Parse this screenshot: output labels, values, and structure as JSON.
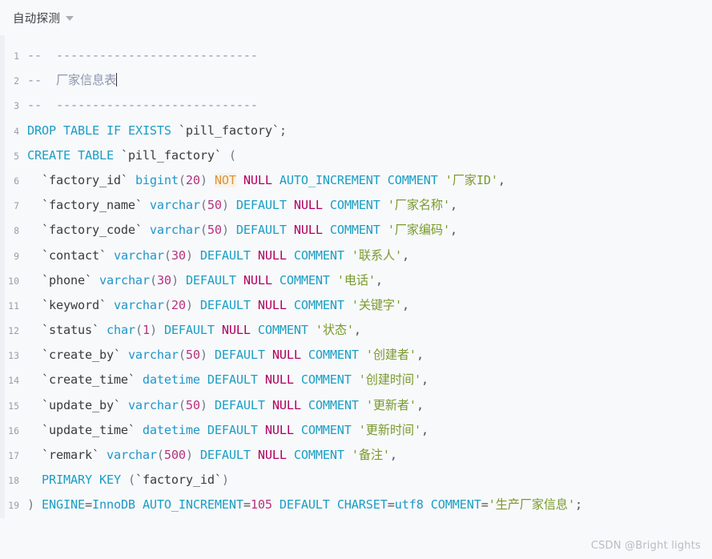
{
  "header": {
    "detect_mode_label": "自动探测",
    "caret_icon": "chevron-down-icon"
  },
  "watermark": "CSDN @Bright lights",
  "colors": {
    "background": "#f8f9fb",
    "gutter": "#eef0f4",
    "line_number": "#9a9ea6",
    "comment": "#8a97ad",
    "keyword": "#2196c9",
    "number": "#b5337f",
    "null_keyword": "#b00060",
    "not_keyword": "#d9943a",
    "string": "#7a9a2e",
    "identifier": "#3b3b3b",
    "watermark": "#b9bcc2"
  },
  "editor": {
    "language": "sql",
    "cursor_line": 2,
    "line_numbers": [
      1,
      2,
      3,
      4,
      5,
      6,
      7,
      8,
      9,
      10,
      11,
      12,
      13,
      14,
      15,
      16,
      17,
      18,
      19
    ],
    "lines": [
      {
        "n": "1",
        "tokens": [
          {
            "t": "comment",
            "v": "--  ----------------------------"
          }
        ]
      },
      {
        "n": "2",
        "tokens": [
          {
            "t": "comment",
            "v": "--  厂家信息表"
          },
          {
            "t": "cursor",
            "v": ""
          }
        ]
      },
      {
        "n": "3",
        "tokens": [
          {
            "t": "comment",
            "v": "--  ----------------------------"
          }
        ]
      },
      {
        "n": "4",
        "tokens": [
          {
            "t": "kw",
            "v": "DROP"
          },
          {
            "t": "plain",
            "v": " "
          },
          {
            "t": "kw",
            "v": "TABLE"
          },
          {
            "t": "plain",
            "v": " "
          },
          {
            "t": "kw",
            "v": "IF"
          },
          {
            "t": "plain",
            "v": " "
          },
          {
            "t": "kw",
            "v": "EXISTS"
          },
          {
            "t": "plain",
            "v": " "
          },
          {
            "t": "ident",
            "v": "`pill_factory`"
          },
          {
            "t": "punct",
            "v": ";"
          }
        ]
      },
      {
        "n": "5",
        "tokens": [
          {
            "t": "kw",
            "v": "CREATE"
          },
          {
            "t": "plain",
            "v": " "
          },
          {
            "t": "kw",
            "v": "TABLE"
          },
          {
            "t": "plain",
            "v": " "
          },
          {
            "t": "ident",
            "v": "`pill_factory`"
          },
          {
            "t": "plain",
            "v": " "
          },
          {
            "t": "paren",
            "v": "("
          }
        ]
      },
      {
        "n": "6",
        "tokens": [
          {
            "t": "plain",
            "v": "  "
          },
          {
            "t": "ident",
            "v": "`factory_id`"
          },
          {
            "t": "plain",
            "v": " "
          },
          {
            "t": "type",
            "v": "bigint"
          },
          {
            "t": "paren",
            "v": "("
          },
          {
            "t": "num",
            "v": "20"
          },
          {
            "t": "paren",
            "v": ")"
          },
          {
            "t": "plain",
            "v": " "
          },
          {
            "t": "not",
            "v": "NOT"
          },
          {
            "t": "plain",
            "v": " "
          },
          {
            "t": "null",
            "v": "NULL"
          },
          {
            "t": "plain",
            "v": " "
          },
          {
            "t": "kw",
            "v": "AUTO_INCREMENT"
          },
          {
            "t": "plain",
            "v": " "
          },
          {
            "t": "kw",
            "v": "COMMENT"
          },
          {
            "t": "plain",
            "v": " "
          },
          {
            "t": "str",
            "v": "'厂家ID'"
          },
          {
            "t": "punct",
            "v": ","
          }
        ]
      },
      {
        "n": "7",
        "tokens": [
          {
            "t": "plain",
            "v": "  "
          },
          {
            "t": "ident",
            "v": "`factory_name`"
          },
          {
            "t": "plain",
            "v": " "
          },
          {
            "t": "type",
            "v": "varchar"
          },
          {
            "t": "paren",
            "v": "("
          },
          {
            "t": "num",
            "v": "50"
          },
          {
            "t": "paren",
            "v": ")"
          },
          {
            "t": "plain",
            "v": " "
          },
          {
            "t": "kw",
            "v": "DEFAULT"
          },
          {
            "t": "plain",
            "v": " "
          },
          {
            "t": "null",
            "v": "NULL"
          },
          {
            "t": "plain",
            "v": " "
          },
          {
            "t": "kw",
            "v": "COMMENT"
          },
          {
            "t": "plain",
            "v": " "
          },
          {
            "t": "str",
            "v": "'厂家名称'"
          },
          {
            "t": "punct",
            "v": ","
          }
        ]
      },
      {
        "n": "8",
        "tokens": [
          {
            "t": "plain",
            "v": "  "
          },
          {
            "t": "ident",
            "v": "`factory_code`"
          },
          {
            "t": "plain",
            "v": " "
          },
          {
            "t": "type",
            "v": "varchar"
          },
          {
            "t": "paren",
            "v": "("
          },
          {
            "t": "num",
            "v": "50"
          },
          {
            "t": "paren",
            "v": ")"
          },
          {
            "t": "plain",
            "v": " "
          },
          {
            "t": "kw",
            "v": "DEFAULT"
          },
          {
            "t": "plain",
            "v": " "
          },
          {
            "t": "null",
            "v": "NULL"
          },
          {
            "t": "plain",
            "v": " "
          },
          {
            "t": "kw",
            "v": "COMMENT"
          },
          {
            "t": "plain",
            "v": " "
          },
          {
            "t": "str",
            "v": "'厂家编码'"
          },
          {
            "t": "punct",
            "v": ","
          }
        ]
      },
      {
        "n": "9",
        "tokens": [
          {
            "t": "plain",
            "v": "  "
          },
          {
            "t": "ident",
            "v": "`contact`"
          },
          {
            "t": "plain",
            "v": " "
          },
          {
            "t": "type",
            "v": "varchar"
          },
          {
            "t": "paren",
            "v": "("
          },
          {
            "t": "num",
            "v": "30"
          },
          {
            "t": "paren",
            "v": ")"
          },
          {
            "t": "plain",
            "v": " "
          },
          {
            "t": "kw",
            "v": "DEFAULT"
          },
          {
            "t": "plain",
            "v": " "
          },
          {
            "t": "null",
            "v": "NULL"
          },
          {
            "t": "plain",
            "v": " "
          },
          {
            "t": "kw",
            "v": "COMMENT"
          },
          {
            "t": "plain",
            "v": " "
          },
          {
            "t": "str",
            "v": "'联系人'"
          },
          {
            "t": "punct",
            "v": ","
          }
        ]
      },
      {
        "n": "10",
        "tokens": [
          {
            "t": "plain",
            "v": "  "
          },
          {
            "t": "ident",
            "v": "`phone`"
          },
          {
            "t": "plain",
            "v": " "
          },
          {
            "t": "type",
            "v": "varchar"
          },
          {
            "t": "paren",
            "v": "("
          },
          {
            "t": "num",
            "v": "30"
          },
          {
            "t": "paren",
            "v": ")"
          },
          {
            "t": "plain",
            "v": " "
          },
          {
            "t": "kw",
            "v": "DEFAULT"
          },
          {
            "t": "plain",
            "v": " "
          },
          {
            "t": "null",
            "v": "NULL"
          },
          {
            "t": "plain",
            "v": " "
          },
          {
            "t": "kw",
            "v": "COMMENT"
          },
          {
            "t": "plain",
            "v": " "
          },
          {
            "t": "str",
            "v": "'电话'"
          },
          {
            "t": "punct",
            "v": ","
          }
        ]
      },
      {
        "n": "11",
        "tokens": [
          {
            "t": "plain",
            "v": "  "
          },
          {
            "t": "ident",
            "v": "`keyword`"
          },
          {
            "t": "plain",
            "v": " "
          },
          {
            "t": "type",
            "v": "varchar"
          },
          {
            "t": "paren",
            "v": "("
          },
          {
            "t": "num",
            "v": "20"
          },
          {
            "t": "paren",
            "v": ")"
          },
          {
            "t": "plain",
            "v": " "
          },
          {
            "t": "kw",
            "v": "DEFAULT"
          },
          {
            "t": "plain",
            "v": " "
          },
          {
            "t": "null",
            "v": "NULL"
          },
          {
            "t": "plain",
            "v": " "
          },
          {
            "t": "kw",
            "v": "COMMENT"
          },
          {
            "t": "plain",
            "v": " "
          },
          {
            "t": "str",
            "v": "'关键字'"
          },
          {
            "t": "punct",
            "v": ","
          }
        ]
      },
      {
        "n": "12",
        "tokens": [
          {
            "t": "plain",
            "v": "  "
          },
          {
            "t": "ident",
            "v": "`status`"
          },
          {
            "t": "plain",
            "v": " "
          },
          {
            "t": "type",
            "v": "char"
          },
          {
            "t": "paren",
            "v": "("
          },
          {
            "t": "num",
            "v": "1"
          },
          {
            "t": "paren",
            "v": ")"
          },
          {
            "t": "plain",
            "v": " "
          },
          {
            "t": "kw",
            "v": "DEFAULT"
          },
          {
            "t": "plain",
            "v": " "
          },
          {
            "t": "null",
            "v": "NULL"
          },
          {
            "t": "plain",
            "v": " "
          },
          {
            "t": "kw",
            "v": "COMMENT"
          },
          {
            "t": "plain",
            "v": " "
          },
          {
            "t": "str",
            "v": "'状态'"
          },
          {
            "t": "punct",
            "v": ","
          }
        ]
      },
      {
        "n": "13",
        "tokens": [
          {
            "t": "plain",
            "v": "  "
          },
          {
            "t": "ident",
            "v": "`create_by`"
          },
          {
            "t": "plain",
            "v": " "
          },
          {
            "t": "type",
            "v": "varchar"
          },
          {
            "t": "paren",
            "v": "("
          },
          {
            "t": "num",
            "v": "50"
          },
          {
            "t": "paren",
            "v": ")"
          },
          {
            "t": "plain",
            "v": " "
          },
          {
            "t": "kw",
            "v": "DEFAULT"
          },
          {
            "t": "plain",
            "v": " "
          },
          {
            "t": "null",
            "v": "NULL"
          },
          {
            "t": "plain",
            "v": " "
          },
          {
            "t": "kw",
            "v": "COMMENT"
          },
          {
            "t": "plain",
            "v": " "
          },
          {
            "t": "str",
            "v": "'创建者'"
          },
          {
            "t": "punct",
            "v": ","
          }
        ]
      },
      {
        "n": "14",
        "tokens": [
          {
            "t": "plain",
            "v": "  "
          },
          {
            "t": "ident",
            "v": "`create_time`"
          },
          {
            "t": "plain",
            "v": " "
          },
          {
            "t": "type",
            "v": "datetime"
          },
          {
            "t": "plain",
            "v": " "
          },
          {
            "t": "kw",
            "v": "DEFAULT"
          },
          {
            "t": "plain",
            "v": " "
          },
          {
            "t": "null",
            "v": "NULL"
          },
          {
            "t": "plain",
            "v": " "
          },
          {
            "t": "kw",
            "v": "COMMENT"
          },
          {
            "t": "plain",
            "v": " "
          },
          {
            "t": "str",
            "v": "'创建时间'"
          },
          {
            "t": "punct",
            "v": ","
          }
        ]
      },
      {
        "n": "15",
        "tokens": [
          {
            "t": "plain",
            "v": "  "
          },
          {
            "t": "ident",
            "v": "`update_by`"
          },
          {
            "t": "plain",
            "v": " "
          },
          {
            "t": "type",
            "v": "varchar"
          },
          {
            "t": "paren",
            "v": "("
          },
          {
            "t": "num",
            "v": "50"
          },
          {
            "t": "paren",
            "v": ")"
          },
          {
            "t": "plain",
            "v": " "
          },
          {
            "t": "kw",
            "v": "DEFAULT"
          },
          {
            "t": "plain",
            "v": " "
          },
          {
            "t": "null",
            "v": "NULL"
          },
          {
            "t": "plain",
            "v": " "
          },
          {
            "t": "kw",
            "v": "COMMENT"
          },
          {
            "t": "plain",
            "v": " "
          },
          {
            "t": "str",
            "v": "'更新者'"
          },
          {
            "t": "punct",
            "v": ","
          }
        ]
      },
      {
        "n": "16",
        "tokens": [
          {
            "t": "plain",
            "v": "  "
          },
          {
            "t": "ident",
            "v": "`update_time`"
          },
          {
            "t": "plain",
            "v": " "
          },
          {
            "t": "type",
            "v": "datetime"
          },
          {
            "t": "plain",
            "v": " "
          },
          {
            "t": "kw",
            "v": "DEFAULT"
          },
          {
            "t": "plain",
            "v": " "
          },
          {
            "t": "null",
            "v": "NULL"
          },
          {
            "t": "plain",
            "v": " "
          },
          {
            "t": "kw",
            "v": "COMMENT"
          },
          {
            "t": "plain",
            "v": " "
          },
          {
            "t": "str",
            "v": "'更新时间'"
          },
          {
            "t": "punct",
            "v": ","
          }
        ]
      },
      {
        "n": "17",
        "tokens": [
          {
            "t": "plain",
            "v": "  "
          },
          {
            "t": "ident",
            "v": "`remark`"
          },
          {
            "t": "plain",
            "v": " "
          },
          {
            "t": "type",
            "v": "varchar"
          },
          {
            "t": "paren",
            "v": "("
          },
          {
            "t": "num",
            "v": "500"
          },
          {
            "t": "paren",
            "v": ")"
          },
          {
            "t": "plain",
            "v": " "
          },
          {
            "t": "kw",
            "v": "DEFAULT"
          },
          {
            "t": "plain",
            "v": " "
          },
          {
            "t": "null",
            "v": "NULL"
          },
          {
            "t": "plain",
            "v": " "
          },
          {
            "t": "kw",
            "v": "COMMENT"
          },
          {
            "t": "plain",
            "v": " "
          },
          {
            "t": "str",
            "v": "'备注'"
          },
          {
            "t": "punct",
            "v": ","
          }
        ]
      },
      {
        "n": "18",
        "tokens": [
          {
            "t": "plain",
            "v": "  "
          },
          {
            "t": "kw",
            "v": "PRIMARY"
          },
          {
            "t": "plain",
            "v": " "
          },
          {
            "t": "kw",
            "v": "KEY"
          },
          {
            "t": "plain",
            "v": " "
          },
          {
            "t": "paren",
            "v": "("
          },
          {
            "t": "ident",
            "v": "`factory_id`"
          },
          {
            "t": "paren",
            "v": ")"
          }
        ]
      },
      {
        "n": "19",
        "tokens": [
          {
            "t": "paren",
            "v": ")"
          },
          {
            "t": "plain",
            "v": " "
          },
          {
            "t": "kw",
            "v": "ENGINE"
          },
          {
            "t": "punct",
            "v": "="
          },
          {
            "t": "type",
            "v": "InnoDB"
          },
          {
            "t": "plain",
            "v": " "
          },
          {
            "t": "kw",
            "v": "AUTO_INCREMENT"
          },
          {
            "t": "punct",
            "v": "="
          },
          {
            "t": "num",
            "v": "105"
          },
          {
            "t": "plain",
            "v": " "
          },
          {
            "t": "kw",
            "v": "DEFAULT"
          },
          {
            "t": "plain",
            "v": " "
          },
          {
            "t": "kw",
            "v": "CHARSET"
          },
          {
            "t": "punct",
            "v": "="
          },
          {
            "t": "type",
            "v": "utf8"
          },
          {
            "t": "plain",
            "v": " "
          },
          {
            "t": "kw",
            "v": "COMMENT"
          },
          {
            "t": "punct",
            "v": "="
          },
          {
            "t": "str",
            "v": "'生产厂家信息'"
          },
          {
            "t": "punct",
            "v": ";"
          }
        ]
      }
    ]
  }
}
